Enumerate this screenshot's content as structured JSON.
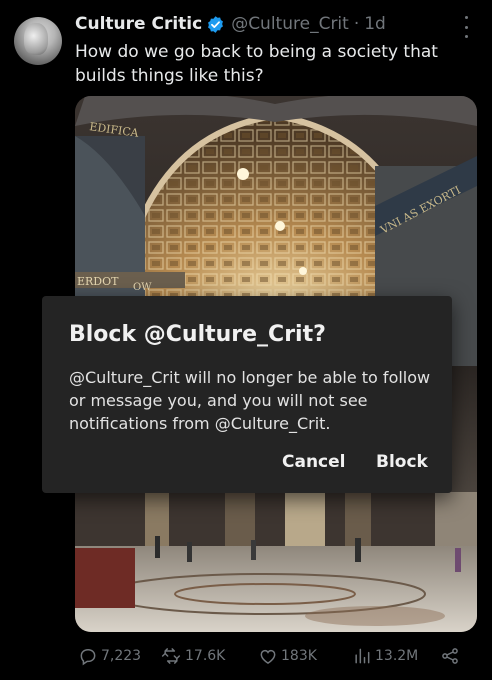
{
  "tweet": {
    "author_name": "Culture Critic",
    "handle": "@Culture_Crit",
    "separator": "·",
    "time": "1d",
    "text": "How do we go back to being a society that builds things like this?",
    "verified_color": "#1d9bf0"
  },
  "media": {
    "inscriptions": [
      "EDIFICA",
      "VNI AS EXORTI",
      "ERDOT",
      "OW"
    ]
  },
  "dialog": {
    "title": "Block @Culture_Crit?",
    "body": "@Culture_Crit will no longer be able to follow or message you, and you will not see notifications from @Culture_Crit.",
    "cancel_label": "Cancel",
    "block_label": "Block"
  },
  "actions": {
    "replies": "7,223",
    "reposts": "17.6K",
    "likes": "183K",
    "views": "13.2M"
  }
}
